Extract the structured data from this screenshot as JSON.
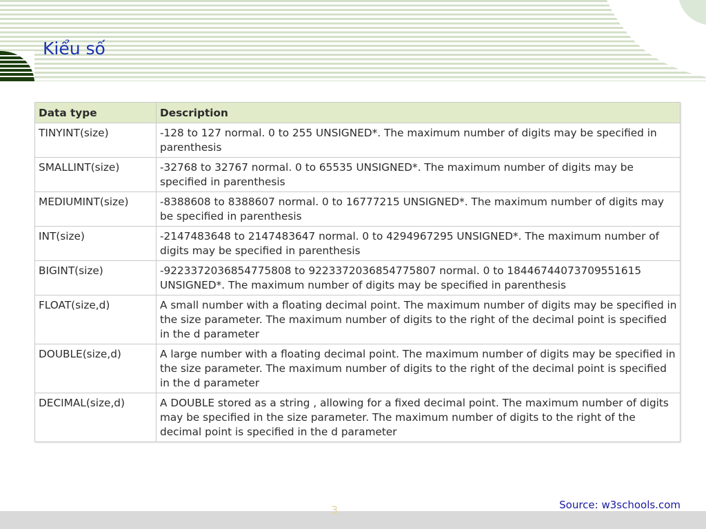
{
  "slide": {
    "title": "Kiểu số",
    "page_number": "3",
    "source": "Source: w3schools.com"
  },
  "colors": {
    "title": "#1a35b0",
    "header_row": "#e2ebc9",
    "stripes": "#d3dfc8",
    "accent_dark_green": "#1c3d0f",
    "footer_band": "#d9d9d9",
    "source_text": "#1a1aa0"
  },
  "table": {
    "headers": [
      "Data type",
      "Description"
    ],
    "rows": [
      {
        "type": "TINYINT(size)",
        "description": "-128 to 127 normal. 0 to 255 UNSIGNED*. The maximum number of digits may be specified in parenthesis"
      },
      {
        "type": "SMALLINT(size)",
        "description": "-32768 to 32767 normal. 0 to 65535 UNSIGNED*. The maximum number of digits may be specified in parenthesis"
      },
      {
        "type": "MEDIUMINT(size)",
        "description": "-8388608 to 8388607 normal. 0 to 16777215 UNSIGNED*. The maximum number of digits may be specified in parenthesis"
      },
      {
        "type": "INT(size)",
        "description": "-2147483648 to 2147483647 normal. 0 to 4294967295 UNSIGNED*. The maximum number of digits may be specified in parenthesis"
      },
      {
        "type": "BIGINT(size)",
        "description": "-9223372036854775808 to 9223372036854775807 normal. 0 to 18446744073709551615 UNSIGNED*. The maximum number of digits may be specified in parenthesis"
      },
      {
        "type": "FLOAT(size,d)",
        "description": "A small number with a floating decimal point. The maximum number of digits may be specified in the size parameter. The maximum number of digits to the right of the decimal point is specified in the d parameter"
      },
      {
        "type": "DOUBLE(size,d)",
        "description": "A large number with a floating decimal point. The maximum number of digits may be specified in the size parameter. The maximum number of digits to the right of the decimal point is specified in the d parameter"
      },
      {
        "type": "DECIMAL(size,d)",
        "description": "A DOUBLE stored as a string , allowing for a fixed decimal point. The maximum number of digits may be specified in the size parameter. The maximum number of digits to the right of the decimal point is specified in the d parameter"
      }
    ]
  }
}
